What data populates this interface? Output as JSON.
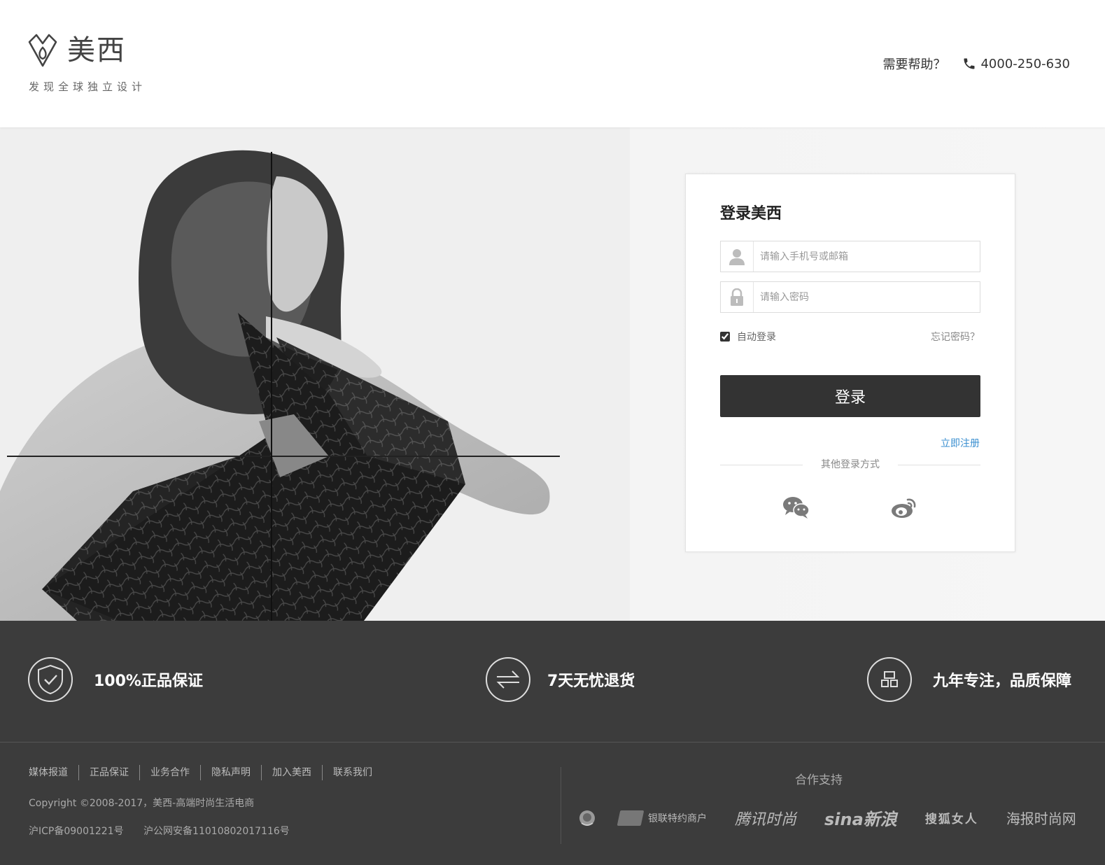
{
  "brand": {
    "name": "美西",
    "tagline": "发现全球独立设计"
  },
  "header": {
    "help_text": "需要帮助？",
    "phone": "4000-250-630"
  },
  "login": {
    "title": "登录美西",
    "username_placeholder": "请输入手机号或邮箱",
    "password_placeholder": "请输入密码",
    "remember_label": "自动登录",
    "remember_checked": true,
    "forgot_label": "忘记密码？",
    "submit_label": "登录",
    "register_label": "立即注册",
    "other_methods_label": "其他登录方式",
    "social": [
      "wechat-icon",
      "weibo-icon"
    ]
  },
  "promises": [
    {
      "icon": "shield-check-icon",
      "text": "100%正品保证"
    },
    {
      "icon": "exchange-arrows-icon",
      "text": "7天无忧退货"
    },
    {
      "icon": "grid-icon",
      "text": "九年专注，品质保障"
    }
  ],
  "footer": {
    "links": [
      "媒体报道",
      "正品保证",
      "业务合作",
      "隐私声明",
      "加入美西",
      "联系我们"
    ],
    "copyright": "Copyright ©2008-2017，美西-高端时尚生活电商",
    "icp": "沪ICP备09001221号",
    "police": "沪公网安备11010802017116号",
    "partners_title": "合作支持",
    "partners": [
      "银联特约商户",
      "腾讯时尚",
      "sina新浪",
      "搜狐女人",
      "海报时尚网"
    ]
  },
  "colors": {
    "button_bg": "#333333",
    "link_blue": "#3a8fd0",
    "band_bg": "#3c3c3c"
  }
}
